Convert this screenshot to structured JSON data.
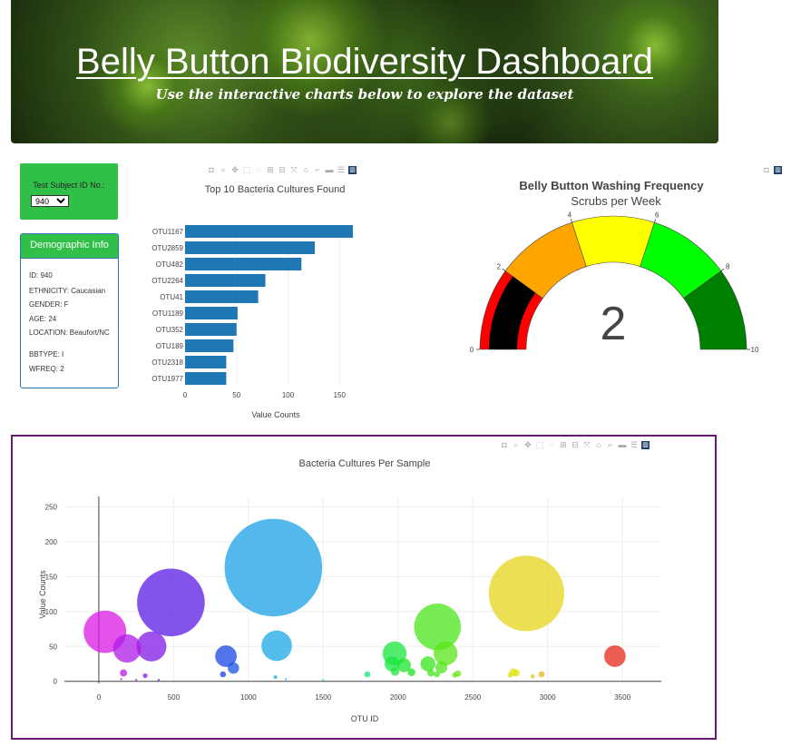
{
  "banner": {
    "title": "Belly Button Biodiversity Dashboard",
    "subtitle": "Use the interactive charts below to explore the dataset"
  },
  "selector": {
    "label": "Test Subject ID No.:",
    "selected": "940",
    "options": [
      "940"
    ]
  },
  "demographic": {
    "heading": "Demographic Info",
    "rows": [
      "ID: 940",
      "ETHNICITY: Caucasian",
      "GENDER: F",
      "AGE: 24",
      "LOCATION: Beaufort/NC",
      "BBTYPE: I",
      "WFREQ: 2"
    ]
  },
  "modebar_icons": [
    "camera-icon",
    "zoom-icon",
    "pan-icon",
    "box-select-icon",
    "lasso-icon",
    "zoom-in-icon",
    "zoom-out-icon",
    "autoscale-icon",
    "reset-axes-icon",
    "spike-lines-icon",
    "hover-closest-icon",
    "hover-compare-icon",
    "plotly-logo-icon"
  ],
  "chart_data": [
    {
      "type": "bar",
      "orientation": "horizontal",
      "title": "Top 10 Bacteria Cultures Found",
      "xlabel": "Value Counts",
      "ylabel": "",
      "categories": [
        "OTU1167",
        "OTU2859",
        "OTU482",
        "OTU2264",
        "OTU41",
        "OTU1189",
        "OTU352",
        "OTU189",
        "OTU2318",
        "OTU1977"
      ],
      "values": [
        163,
        126,
        113,
        78,
        71,
        51,
        50,
        47,
        40,
        40
      ],
      "xlim": [
        0,
        170
      ],
      "xticks": [
        "0",
        "50",
        "100",
        "150"
      ],
      "color": "#1f77b4"
    },
    {
      "type": "gauge",
      "title": "Belly Button Washing Frequency",
      "subtitle": "Scrubs per Week",
      "value": 2,
      "value_label": "2",
      "range": [
        0,
        10
      ],
      "ticks": [
        "0",
        "2",
        "4",
        "6",
        "8",
        "10"
      ],
      "bands": [
        {
          "from": 0,
          "to": 2,
          "color": "#ff0000"
        },
        {
          "from": 2,
          "to": 4,
          "color": "#ffa500"
        },
        {
          "from": 4,
          "to": 6,
          "color": "#ffff00"
        },
        {
          "from": 6,
          "to": 8,
          "color": "#00ff00"
        },
        {
          "from": 8,
          "to": 10,
          "color": "#008000"
        }
      ],
      "bar_color": "#000000"
    },
    {
      "type": "scatter",
      "title": "Bacteria Cultures Per Sample",
      "xlabel": "OTU ID",
      "ylabel": "Value Counts",
      "xlim": [
        -230,
        3760
      ],
      "ylim": [
        -3,
        265
      ],
      "xticks": [
        "0",
        "500",
        "1000",
        "1500",
        "2000",
        "2500",
        "3000",
        "3500"
      ],
      "yticks": [
        "0",
        "50",
        "100",
        "150",
        "200",
        "250"
      ],
      "points": [
        {
          "x": 41,
          "y": 71
        },
        {
          "x": 189,
          "y": 47
        },
        {
          "x": 352,
          "y": 50
        },
        {
          "x": 482,
          "y": 113
        },
        {
          "x": 165,
          "y": 12
        },
        {
          "x": 310,
          "y": 8
        },
        {
          "x": 150,
          "y": 3
        },
        {
          "x": 250,
          "y": 2
        },
        {
          "x": 400,
          "y": 2
        },
        {
          "x": 850,
          "y": 36
        },
        {
          "x": 900,
          "y": 19
        },
        {
          "x": 830,
          "y": 10
        },
        {
          "x": 1167,
          "y": 163
        },
        {
          "x": 1189,
          "y": 51
        },
        {
          "x": 1180,
          "y": 6
        },
        {
          "x": 1250,
          "y": 3
        },
        {
          "x": 1500,
          "y": 2
        },
        {
          "x": 1795,
          "y": 10
        },
        {
          "x": 1977,
          "y": 40
        },
        {
          "x": 1960,
          "y": 25
        },
        {
          "x": 2040,
          "y": 23
        },
        {
          "x": 1980,
          "y": 14
        },
        {
          "x": 2090,
          "y": 13
        },
        {
          "x": 2264,
          "y": 78
        },
        {
          "x": 2318,
          "y": 40
        },
        {
          "x": 2200,
          "y": 25
        },
        {
          "x": 2290,
          "y": 20
        },
        {
          "x": 2220,
          "y": 12
        },
        {
          "x": 2260,
          "y": 10
        },
        {
          "x": 2400,
          "y": 11
        },
        {
          "x": 2380,
          "y": 9
        },
        {
          "x": 2859,
          "y": 126
        },
        {
          "x": 2790,
          "y": 12
        },
        {
          "x": 2750,
          "y": 9
        },
        {
          "x": 2770,
          "y": 13
        },
        {
          "x": 2960,
          "y": 10
        },
        {
          "x": 2900,
          "y": 7
        },
        {
          "x": 3450,
          "y": 36
        }
      ]
    }
  ]
}
